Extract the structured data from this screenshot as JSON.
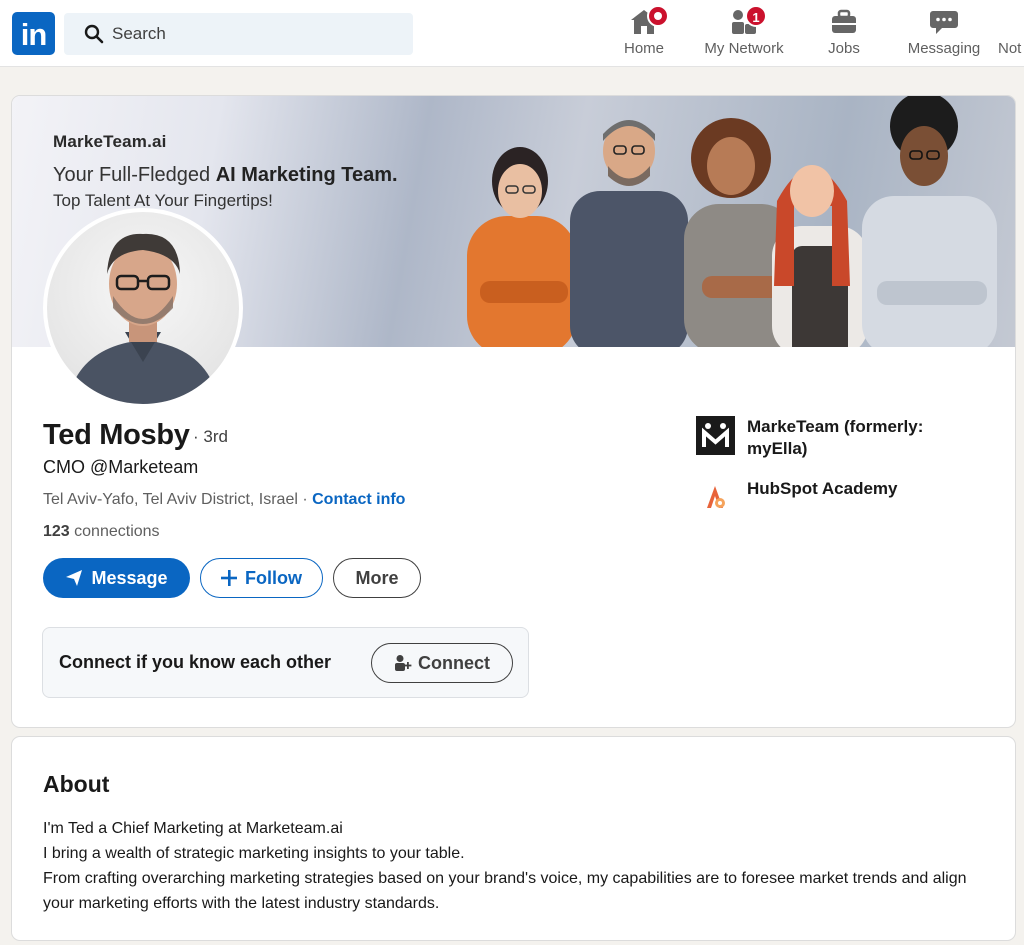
{
  "nav": {
    "logo_text": "in",
    "search_placeholder": "Search",
    "items": [
      {
        "label": "Home",
        "icon": "home-icon",
        "badge": ""
      },
      {
        "label": "My Network",
        "icon": "network-icon",
        "badge": "1"
      },
      {
        "label": "Jobs",
        "icon": "briefcase-icon",
        "badge": ""
      },
      {
        "label": "Messaging",
        "icon": "messaging-icon",
        "badge": ""
      },
      {
        "label": "Not",
        "icon": "bell-icon",
        "badge": ""
      }
    ]
  },
  "banner": {
    "brand": "MarkeTeam.ai",
    "line1_prefix": "Your Full-Fledged ",
    "line1_bold": "AI Marketing Team.",
    "line2": "Top Talent At Your Fingertips!"
  },
  "profile": {
    "name": "Ted Mosby",
    "degree": "· 3rd",
    "headline": "CMO @Marketeam",
    "location": "Tel Aviv-Yafo, Tel Aviv District, Israel",
    "location_sep": " · ",
    "contact_info": "Contact info",
    "connections_count": "123",
    "connections_label": " connections",
    "buttons": {
      "message": "Message",
      "follow": "Follow",
      "more": "More"
    },
    "connect_prompt": "Connect if you know each other",
    "connect_button": "Connect",
    "organizations": [
      {
        "name": "MarkeTeam (formerly: myElla)",
        "icon": "marketeam-logo"
      },
      {
        "name": "HubSpot Academy",
        "icon": "hubspot-academy-logo"
      }
    ]
  },
  "about": {
    "title": "About",
    "lines": [
      "I'm Ted a Chief Marketing at Marketeam.ai",
      "I bring a wealth of strategic marketing insights to your table.",
      "From crafting overarching marketing strategies based on your brand's voice, my capabilities are to foresee market trends and align your marketing efforts with the latest industry standards."
    ]
  },
  "colors": {
    "brand_blue": "#0a66c2",
    "badge_red": "#cb112d",
    "page_bg": "#f4f2ee"
  }
}
